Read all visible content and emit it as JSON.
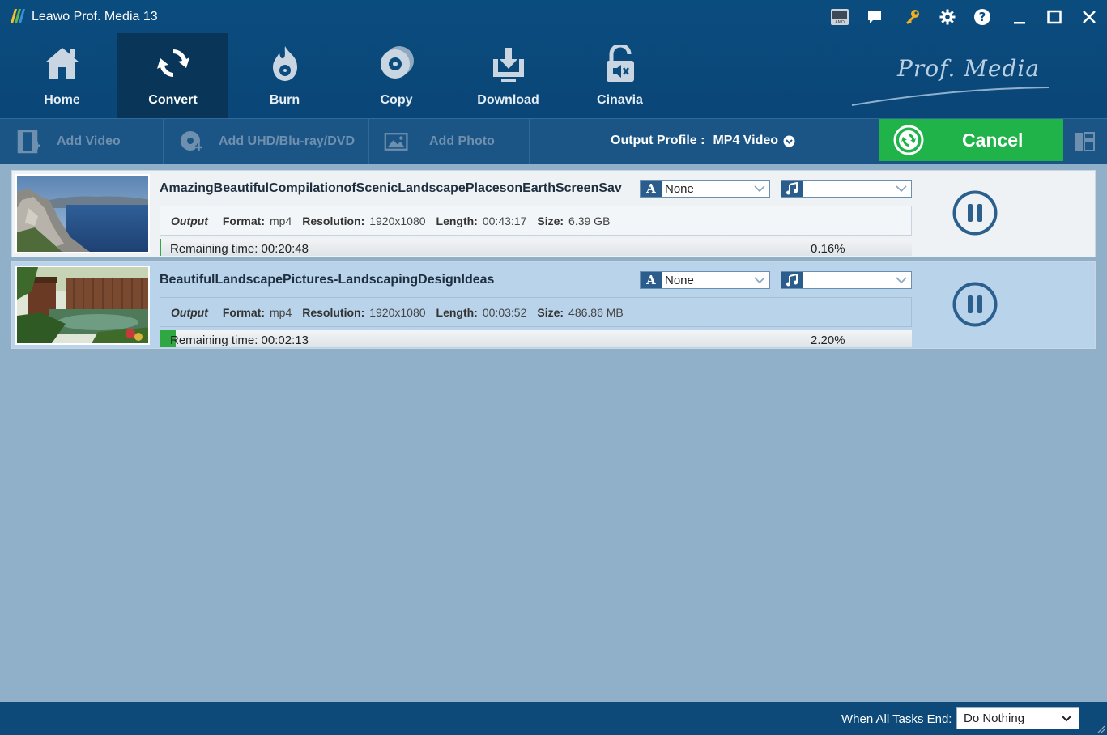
{
  "window": {
    "title": "Leawo Prof. Media 13",
    "titlebar_icons": [
      "amd-icon",
      "feedback-icon",
      "register-key-icon",
      "settings-icon",
      "help-icon",
      "minimize-icon",
      "maximize-icon",
      "close-icon"
    ]
  },
  "nav": {
    "items": [
      {
        "label": "Home",
        "icon": "home-icon"
      },
      {
        "label": "Convert",
        "icon": "convert-icon",
        "active": true
      },
      {
        "label": "Burn",
        "icon": "burn-icon"
      },
      {
        "label": "Copy",
        "icon": "copy-icon"
      },
      {
        "label": "Download",
        "icon": "download-icon"
      },
      {
        "label": "Cinavia",
        "icon": "cinavia-icon"
      }
    ],
    "brand": "Prof. Media"
  },
  "toolbar": {
    "add_video": "Add Video",
    "add_disc": "Add UHD/Blu-ray/DVD",
    "add_photo": "Add Photo",
    "output_profile_label": "Output Profile :",
    "output_profile_value": "MP4 Video",
    "cancel_label": "Cancel"
  },
  "tasks": [
    {
      "name": "AmazingBeautifulCompilationofScenicLandscapePlacesonEarthScreenSav",
      "subtitle": "None",
      "audio": "",
      "output_label": "Output",
      "format_label": "Format:",
      "format": "mp4",
      "resolution_label": "Resolution:",
      "resolution": "1920x1080",
      "length_label": "Length:",
      "length": "00:43:17",
      "size_label": "Size:",
      "size": "6.39 GB",
      "remaining": "Remaining time: 00:20:48",
      "percent": "0.16%",
      "progress": 0.0016
    },
    {
      "name": "BeautifulLandscapePictures-LandscapingDesignIdeas",
      "subtitle": "None",
      "audio": "",
      "output_label": "Output",
      "format_label": "Format:",
      "format": "mp4",
      "resolution_label": "Resolution:",
      "resolution": "1920x1080",
      "length_label": "Length:",
      "length": "00:03:52",
      "size_label": "Size:",
      "size": "486.86 MB",
      "remaining": "Remaining time: 00:02:13",
      "percent": "2.20%",
      "progress": 0.022
    }
  ],
  "footer": {
    "when_end_label": "When All Tasks End:",
    "when_end_value": "Do Nothing"
  },
  "colors": {
    "accent_green": "#1fb34a",
    "header_blue": "#0b4c7e",
    "list_bg": "#8fb0c8"
  }
}
